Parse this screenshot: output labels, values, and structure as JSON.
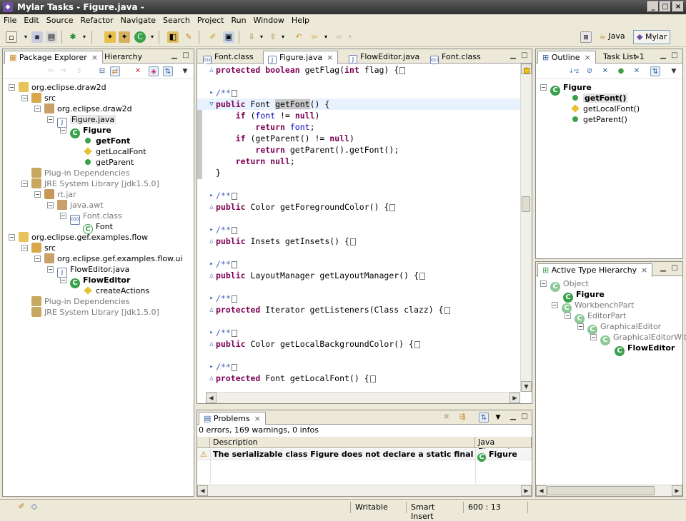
{
  "window": {
    "title": "Mylar Tasks - Figure.java -",
    "min": "_",
    "max": "□",
    "close": "×"
  },
  "menu": [
    "File",
    "Edit",
    "Source",
    "Refactor",
    "Navigate",
    "Search",
    "Project",
    "Run",
    "Window",
    "Help"
  ],
  "perspectives": {
    "java": "Java",
    "mylar": "Mylar"
  },
  "left_panel": {
    "tabs": [
      {
        "label": "Package Explorer",
        "close": "×"
      },
      {
        "label": "Hierarchy"
      }
    ],
    "tree": [
      {
        "label": "org.eclipse.draw2d",
        "icon": "project-icon"
      },
      {
        "label": "src",
        "icon": "source-folder-icon"
      },
      {
        "label": "org.eclipse.draw2d",
        "icon": "package-icon"
      },
      {
        "label": "Figure.java",
        "icon": "java-file-icon"
      },
      {
        "label": "Figure",
        "icon": "class-icon"
      },
      {
        "label": "getFont",
        "icon": "public-method-icon"
      },
      {
        "label": "getLocalFont",
        "icon": "protected-method-icon"
      },
      {
        "label": "getParent",
        "icon": "public-method-icon"
      },
      {
        "label": "Plug-in Dependencies",
        "icon": "library-icon"
      },
      {
        "label": "JRE System Library [jdk1.5.0]",
        "icon": "library-icon"
      },
      {
        "label": "rt.jar",
        "icon": "jar-icon"
      },
      {
        "label": "java.awt",
        "icon": "package-icon"
      },
      {
        "label": "Font.class",
        "icon": "class-file-icon"
      },
      {
        "label": "Font",
        "icon": "class-icon"
      },
      {
        "label": "org.eclipse.gef.examples.flow",
        "icon": "project-icon"
      },
      {
        "label": "src",
        "icon": "source-folder-icon"
      },
      {
        "label": "org.eclipse.gef.examples.flow.ui",
        "icon": "package-icon"
      },
      {
        "label": "FlowEditor.java",
        "icon": "java-file-icon"
      },
      {
        "label": "FlowEditor",
        "icon": "class-icon"
      },
      {
        "label": "createActions",
        "icon": "protected-method-icon"
      },
      {
        "label": "Plug-in Dependencies",
        "icon": "library-icon"
      },
      {
        "label": "JRE System Library [jdk1.5.0]",
        "icon": "library-icon"
      }
    ]
  },
  "editor": {
    "tabs": [
      {
        "label": "Font.class",
        "icon": "class-file-icon"
      },
      {
        "label": "Figure.java",
        "icon": "java-file-icon",
        "close": "×"
      },
      {
        "label": "FlowEditor.java",
        "icon": "java-file-icon"
      },
      {
        "label": "Font.class",
        "icon": "class-file-icon"
      }
    ],
    "lines": [
      {
        "segs": [
          [
            "kw",
            "protected boolean "
          ],
          [
            "",
            "getFlag("
          ],
          [
            "kw",
            "int"
          ],
          [
            "",
            " flag) {"
          ]
        ],
        "box": true
      },
      {
        "segs": []
      },
      {
        "segs": [
          [
            "cm",
            "/**"
          ]
        ],
        "box": true
      },
      {
        "segs": [
          [
            "kw",
            "public"
          ],
          [
            "",
            " Font "
          ],
          [
            "hl",
            "getFont"
          ],
          [
            "",
            "() {"
          ]
        ],
        "current": true
      },
      {
        "segs": [
          [
            "",
            "    "
          ],
          [
            "kw",
            "if"
          ],
          [
            "",
            " ("
          ],
          [
            "fd",
            "font"
          ],
          [
            "",
            " != "
          ],
          [
            "kw",
            "null"
          ],
          [
            "",
            ")"
          ]
        ]
      },
      {
        "segs": [
          [
            "",
            "        "
          ],
          [
            "kw",
            "return"
          ],
          [
            "",
            " "
          ],
          [
            "fd",
            "font"
          ],
          [
            "",
            ";"
          ]
        ]
      },
      {
        "segs": [
          [
            "",
            "    "
          ],
          [
            "kw",
            "if"
          ],
          [
            "",
            " (getParent() != "
          ],
          [
            "kw",
            "null"
          ],
          [
            "",
            ")"
          ]
        ]
      },
      {
        "segs": [
          [
            "",
            "        "
          ],
          [
            "kw",
            "return"
          ],
          [
            "",
            " getParent().getFont();"
          ]
        ]
      },
      {
        "segs": [
          [
            "",
            "    "
          ],
          [
            "kw",
            "return null"
          ],
          [
            "",
            ";"
          ]
        ]
      },
      {
        "segs": [
          [
            "",
            "}"
          ]
        ]
      },
      {
        "segs": []
      },
      {
        "segs": [
          [
            "cm",
            "/**"
          ]
        ],
        "box": true
      },
      {
        "segs": [
          [
            "kw",
            "public"
          ],
          [
            "",
            " Color getForegroundColor() {"
          ]
        ],
        "box": true
      },
      {
        "segs": []
      },
      {
        "segs": [
          [
            "cm",
            "/**"
          ]
        ],
        "box": true
      },
      {
        "segs": [
          [
            "kw",
            "public"
          ],
          [
            "",
            " Insets getInsets() {"
          ]
        ],
        "box": true
      },
      {
        "segs": []
      },
      {
        "segs": [
          [
            "cm",
            "/**"
          ]
        ],
        "box": true
      },
      {
        "segs": [
          [
            "kw",
            "public"
          ],
          [
            "",
            " LayoutManager getLayoutManager() {"
          ]
        ],
        "box": true
      },
      {
        "segs": []
      },
      {
        "segs": [
          [
            "cm",
            "/**"
          ]
        ],
        "box": true
      },
      {
        "segs": [
          [
            "kw",
            "protected"
          ],
          [
            "",
            " Iterator getListeners(Class clazz) {"
          ]
        ],
        "box": true
      },
      {
        "segs": []
      },
      {
        "segs": [
          [
            "cm",
            "/**"
          ]
        ],
        "box": true
      },
      {
        "segs": [
          [
            "kw",
            "public"
          ],
          [
            "",
            " Color getLocalBackgroundColor() {"
          ]
        ],
        "box": true
      },
      {
        "segs": []
      },
      {
        "segs": [
          [
            "cm",
            "/**"
          ]
        ],
        "box": true
      },
      {
        "segs": [
          [
            "kw",
            "protected"
          ],
          [
            "",
            " Font getLocalFont() {"
          ]
        ],
        "box": true
      }
    ]
  },
  "outline": {
    "tabs": [
      {
        "label": "Outline",
        "close": "×"
      },
      {
        "label": "Task List"
      },
      {
        "label": "»1"
      }
    ],
    "tree": [
      {
        "label": "Figure",
        "icon": "class-icon"
      },
      {
        "label": "getFont()",
        "icon": "public-method-icon"
      },
      {
        "label": "getLocalFont()",
        "icon": "protected-method-icon"
      },
      {
        "label": "getParent()",
        "icon": "public-method-icon"
      }
    ]
  },
  "hierarchy": {
    "tab": "Active Type Hierarchy",
    "close": "×",
    "tree": [
      {
        "label": "Object",
        "icon": "class-icon"
      },
      {
        "label": "Figure",
        "icon": "class-icon"
      },
      {
        "label": "WorkbenchPart",
        "icon": "class-icon"
      },
      {
        "label": "EditorPart",
        "icon": "class-icon"
      },
      {
        "label": "GraphicalEditor",
        "icon": "class-icon"
      },
      {
        "label": "GraphicalEditorWithP",
        "icon": "class-icon"
      },
      {
        "label": "FlowEditor",
        "icon": "class-icon"
      }
    ]
  },
  "problems": {
    "tab": "Problems",
    "close": "×",
    "summary": "0 errors, 169 warnings, 0 infos",
    "columns": [
      "Description",
      "Java Element"
    ],
    "rows": [
      {
        "description": "The serializable class Figure does not declare a static final serialVe...",
        "element": "Figure"
      }
    ]
  },
  "status": {
    "writable": "Writable",
    "mode": "Smart Insert",
    "position": "600 : 13"
  }
}
